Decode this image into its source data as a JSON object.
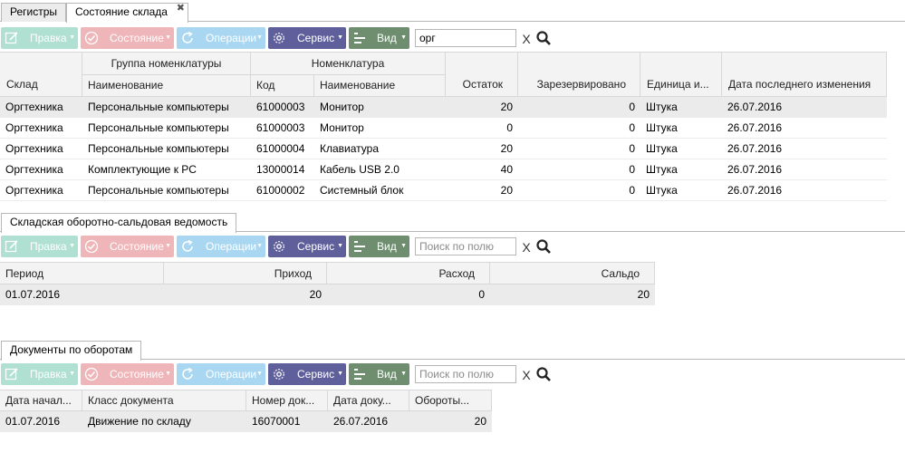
{
  "top_tabs": [
    {
      "label": "Регистры"
    },
    {
      "label": "Состояние склада"
    }
  ],
  "toolbar_labels": {
    "pravka": "Правка",
    "sostoyanie": "Состояние",
    "operacii": "Операции",
    "servis": "Сервис",
    "vid": "Вид",
    "clear": "X"
  },
  "stock": {
    "search_value": "орг",
    "group_headers": {
      "group": "Группа номенклатуры",
      "nomenclature": "Номенклатура"
    },
    "columns": [
      "Склад",
      "Наименование",
      "Код",
      "Наименование",
      "Остаток",
      "Зарезервировано",
      "Единица и...",
      "Дата последнего изменения"
    ],
    "rows": [
      [
        "Оргтехника",
        "Персональные компьютеры",
        "61000003",
        "Монитор",
        "20",
        "0",
        "Штука",
        "26.07.2016"
      ],
      [
        "Оргтехника",
        "Персональные компьютеры",
        "61000003",
        "Монитор",
        "0",
        "0",
        "Штука",
        "26.07.2016"
      ],
      [
        "Оргтехника",
        "Персональные компьютеры",
        "61000004",
        "Клавиатура",
        "20",
        "0",
        "Штука",
        "26.07.2016"
      ],
      [
        "Оргтехника",
        "Комплектующие к PC",
        "13000014",
        "Кабель USB 2.0",
        "40",
        "0",
        "Штука",
        "26.07.2016"
      ],
      [
        "Оргтехника",
        "Персональные компьютеры",
        "61000002",
        "Системный блок",
        "20",
        "0",
        "Штука",
        "26.07.2016"
      ]
    ]
  },
  "turnover": {
    "tab_label": "Складская оборотно-сальдовая ведомость",
    "search_placeholder": "Поиск по полю",
    "columns": [
      "Период",
      "Приход",
      "Расход",
      "Сальдо"
    ],
    "rows": [
      [
        "01.07.2016",
        "20",
        "0",
        "20"
      ]
    ]
  },
  "documents": {
    "tab_label": "Документы по оборотам",
    "search_placeholder": "Поиск по полю",
    "columns": [
      "Дата начал...",
      "Класс документа",
      "Номер док...",
      "Дата доку...",
      "Обороты..."
    ],
    "rows": [
      [
        "01.07.2016",
        "Движение по складу",
        "16070001",
        "26.07.2016",
        "20"
      ]
    ]
  },
  "icons": {
    "pravka": "edit-icon",
    "sostoyanie": "check-circle-icon",
    "operacii": "refresh-icon",
    "servis": "gear-icon",
    "vid": "list-view-icon",
    "search": "search-icon"
  },
  "colors": {
    "pravka": "#6ec8ac",
    "sostoyanie": "#e37c80",
    "operacii": "#63b8e6",
    "servis": "#5f5f9b",
    "vid": "#6f8e70"
  }
}
